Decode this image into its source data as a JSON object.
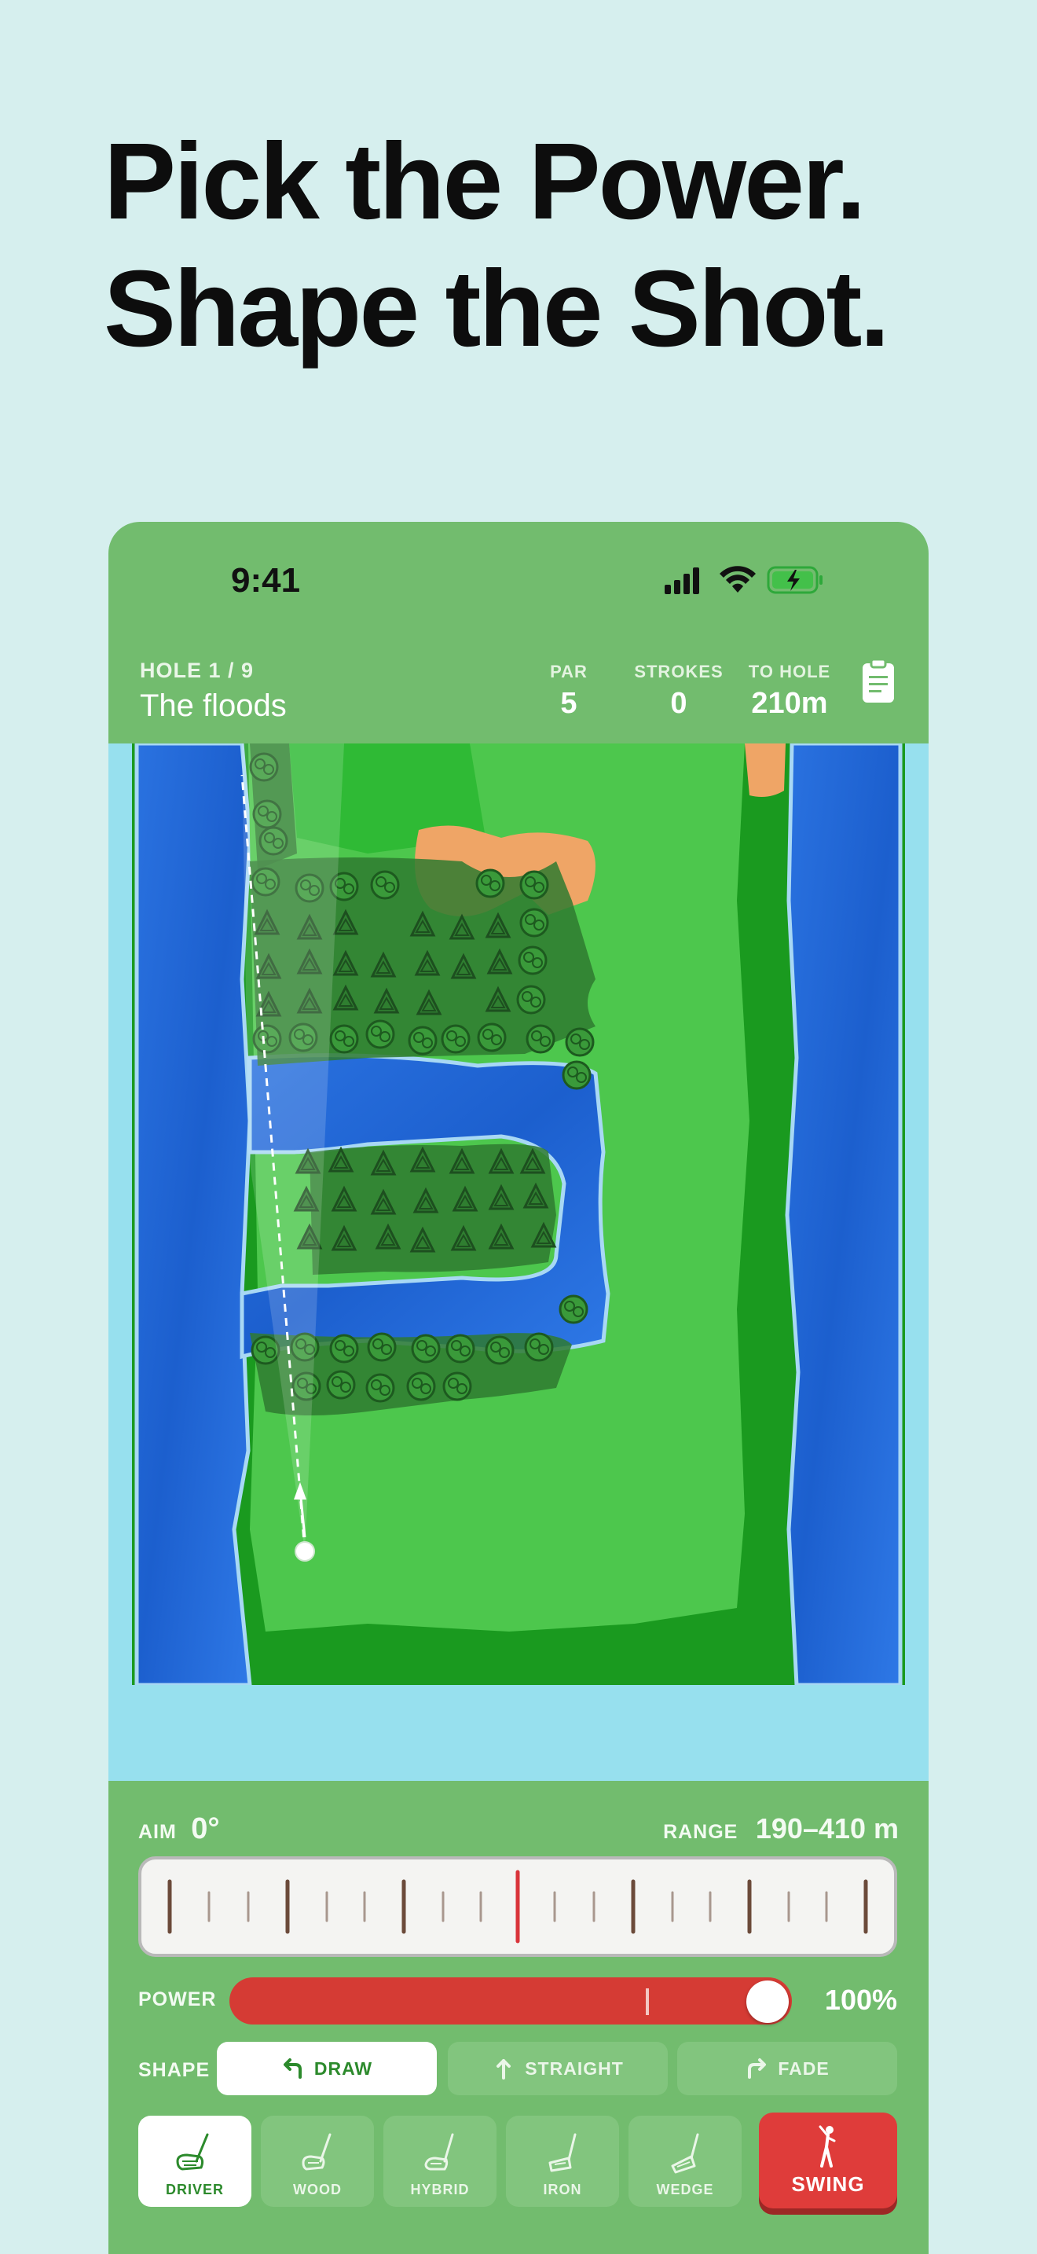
{
  "headline": {
    "line1": "Pick the Power.",
    "line2": "Shape the Shot."
  },
  "status_bar": {
    "time": "9:41"
  },
  "hud": {
    "hole_label": "HOLE 1 / 9",
    "hole_name": "The floods",
    "par_label": "PAR",
    "par_value": "5",
    "strokes_label": "STROKES",
    "strokes_value": "0",
    "to_hole_label": "TO HOLE",
    "to_hole_value": "210m"
  },
  "controls": {
    "aim_label": "AIM",
    "aim_value": "0°",
    "range_label": "RANGE",
    "range_value": "190–410 m",
    "power_label": "POWER",
    "power_value": "100%",
    "power_fraction": 1.0,
    "shape_label": "SHAPE",
    "shapes": [
      {
        "label": "DRAW",
        "icon": "draw-arrow-icon",
        "active": true
      },
      {
        "label": "STRAIGHT",
        "icon": "straight-arrow-icon",
        "active": false
      },
      {
        "label": "FADE",
        "icon": "fade-arrow-icon",
        "active": false
      }
    ],
    "clubs": [
      {
        "label": "DRIVER",
        "icon": "driver-club-icon",
        "active": true
      },
      {
        "label": "WOOD",
        "icon": "wood-club-icon",
        "active": false
      },
      {
        "label": "HYBRID",
        "icon": "hybrid-club-icon",
        "active": false
      },
      {
        "label": "IRON",
        "icon": "iron-club-icon",
        "active": false
      },
      {
        "label": "WEDGE",
        "icon": "wedge-club-icon",
        "active": false
      }
    ],
    "swing_label": "SWING"
  },
  "colors": {
    "background": "#d6efee",
    "panel": "#72bc6e",
    "water": "#1f66d6",
    "fairway": "#4cc84c",
    "rough": "#1c9c22",
    "sand": "#efa566",
    "power": "#d53b34",
    "swing": "#df3c3a"
  }
}
